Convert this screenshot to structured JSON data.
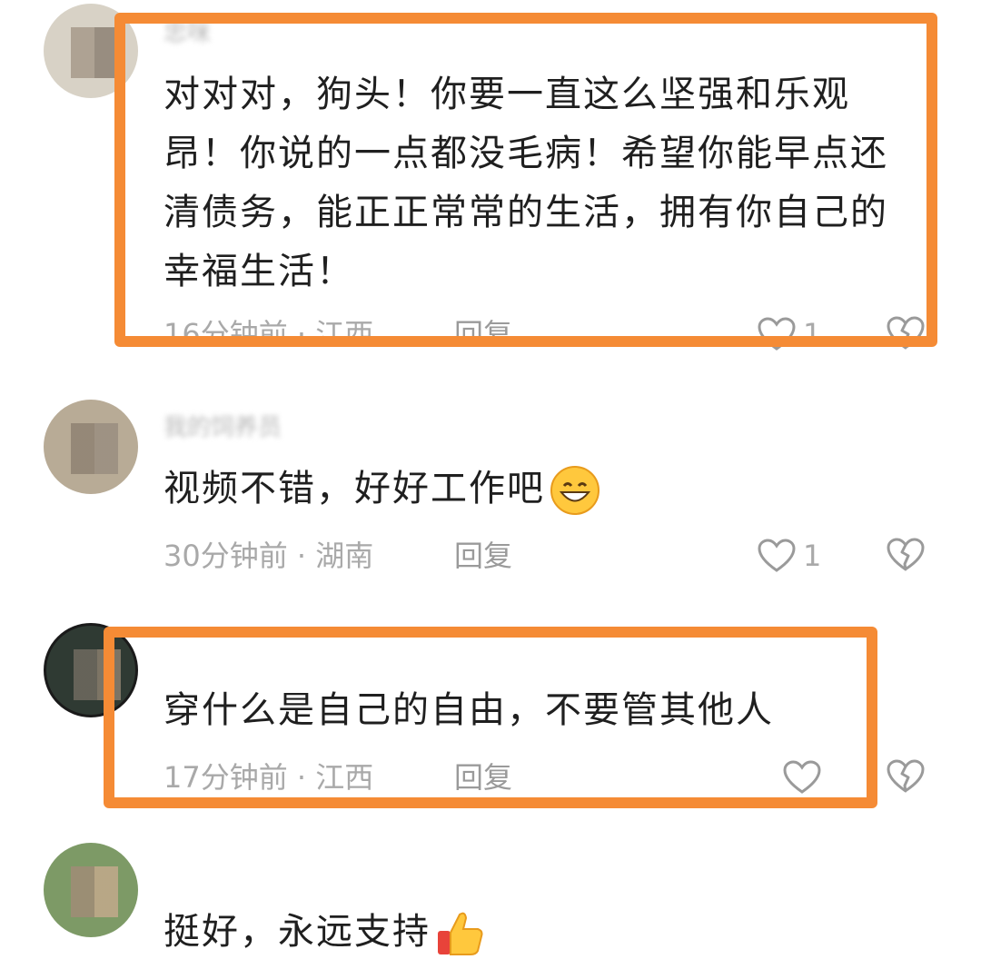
{
  "comments": [
    {
      "username": "忠咪",
      "text": "对对对，狗头！你要一直这么坚强和乐观昂！你说的一点都没毛病！希望你能早点还清债务，能正正常常的生活，拥有你自己的幸福生活！",
      "meta": "16分钟前 · 江西",
      "reply_label": "回复",
      "likes": "1"
    },
    {
      "username": "我的饲养员",
      "text": "视频不错，好好工作吧",
      "emoji": "grinning-face-emoji",
      "meta": "30分钟前 · 湖南",
      "reply_label": "回复",
      "likes": "1"
    },
    {
      "username": "",
      "text": "穿什么是自己的自由，不要管其他人",
      "meta": "17分钟前 · 江西",
      "reply_label": "回复",
      "likes": ""
    },
    {
      "username": "",
      "text": "挺好，永远支持",
      "emoji": "thumbs-up-emoji",
      "meta": "",
      "reply_label": "",
      "likes": ""
    }
  ],
  "icons": {
    "like": "heart-outline-icon",
    "dislike": "broken-heart-icon"
  },
  "colors": {
    "highlight": "#f58b35",
    "text": "#1f1f1f",
    "meta": "#a9a9a9"
  }
}
